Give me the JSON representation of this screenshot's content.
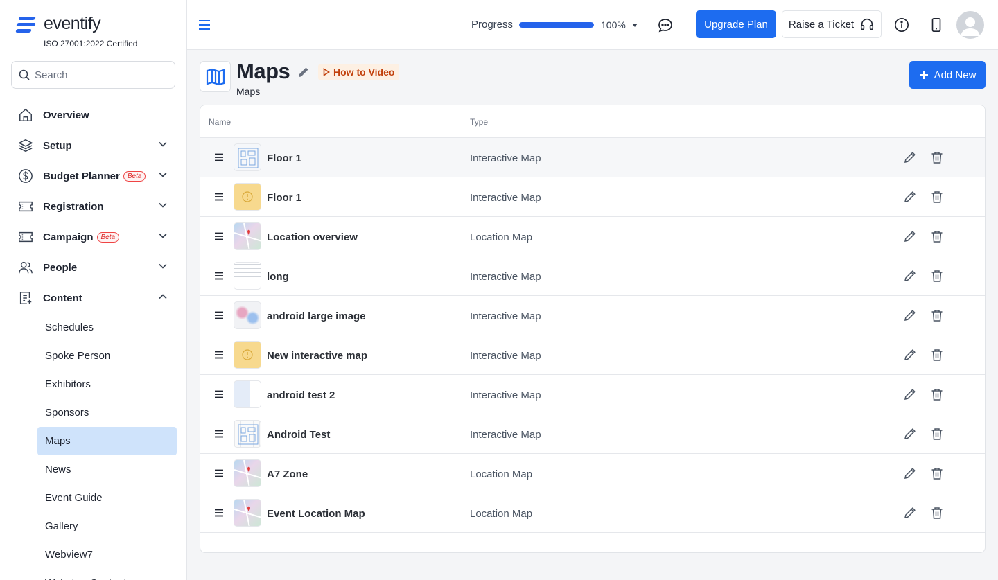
{
  "app": {
    "brand": "eventify",
    "certification": "ISO 27001:2022 Certified"
  },
  "search": {
    "placeholder": "Search"
  },
  "sidebar": {
    "items": [
      {
        "label": "Overview",
        "icon": "home-icon",
        "expandable": false
      },
      {
        "label": "Setup",
        "icon": "layers-icon",
        "expandable": true
      },
      {
        "label": "Budget Planner",
        "icon": "dollar-icon",
        "badge": "Beta",
        "expandable": true
      },
      {
        "label": "Registration",
        "icon": "ticket-icon",
        "expandable": true
      },
      {
        "label": "Campaign",
        "icon": "ticket-icon",
        "badge": "Beta",
        "expandable": true
      },
      {
        "label": "People",
        "icon": "people-icon",
        "expandable": true
      },
      {
        "label": "Content",
        "icon": "document-icon",
        "expandable": true,
        "expanded": true
      }
    ],
    "content_sub": [
      "Schedules",
      "Spoke Person",
      "Exhibitors",
      "Sponsors",
      "Maps",
      "News",
      "Event Guide",
      "Gallery",
      "Webview7",
      "Webview Content"
    ],
    "active_sub": "Maps"
  },
  "topbar": {
    "progress_label": "Progress",
    "progress_value": 100,
    "progress_text": "100%",
    "upgrade_label": "Upgrade Plan",
    "ticket_label": "Raise a Ticket"
  },
  "page": {
    "title": "Maps",
    "how_to": "How to Video",
    "breadcrumb": "Maps",
    "add_new": "Add New"
  },
  "table": {
    "columns": [
      "Name",
      "Type"
    ],
    "rows": [
      {
        "name": "Floor 1",
        "type": "Interactive Map",
        "thumb": "floorplan"
      },
      {
        "name": "Floor 1",
        "type": "Interactive Map",
        "thumb": "warning"
      },
      {
        "name": "Location overview",
        "type": "Location Map",
        "thumb": "map"
      },
      {
        "name": "long",
        "type": "Interactive Map",
        "thumb": "lines"
      },
      {
        "name": "android large image",
        "type": "Interactive Map",
        "thumb": "blur"
      },
      {
        "name": "New interactive map",
        "type": "Interactive Map",
        "thumb": "warning"
      },
      {
        "name": "android test 2",
        "type": "Interactive Map",
        "thumb": "mixed"
      },
      {
        "name": "Android Test",
        "type": "Interactive Map",
        "thumb": "grid"
      },
      {
        "name": "A7 Zone",
        "type": "Location Map",
        "thumb": "map"
      },
      {
        "name": "Event Location Map",
        "type": "Location Map",
        "thumb": "map"
      }
    ]
  },
  "colors": {
    "primary": "#1d6cf0",
    "active_nav": "#cfe3fb",
    "beta_red": "#dc2626",
    "howto_orange": "#c2410c"
  }
}
